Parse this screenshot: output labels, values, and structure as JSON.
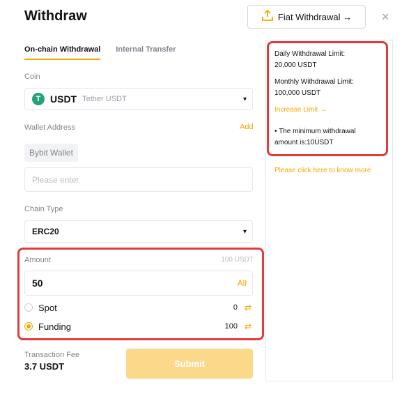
{
  "header": {
    "title": "Withdraw",
    "fiat_button": "Fiat Withdrawal →",
    "close": "×"
  },
  "tabs": [
    {
      "label": "On-chain Withdrawal",
      "active": true
    },
    {
      "label": "Internal Transfer",
      "active": false
    }
  ],
  "coin": {
    "label": "Coin",
    "code": "USDT",
    "name": "Tether USDT",
    "icon_letter": "T"
  },
  "wallet": {
    "label": "Wallet Address",
    "add_link": "Add",
    "tag": "Bybit Wallet",
    "placeholder": "Please enter"
  },
  "chain": {
    "label": "Chain Type",
    "value": "ERC20"
  },
  "amount": {
    "label": "Amount",
    "max": "100 USDT",
    "value": "50",
    "all_button": "All",
    "accounts": [
      {
        "label": "Spot",
        "balance": "0",
        "selected": false
      },
      {
        "label": "Funding",
        "balance": "100",
        "selected": true
      }
    ]
  },
  "fee": {
    "label": "Transaction Fee",
    "value": "3.7 USDT"
  },
  "submit_label": "Submit",
  "side_panel": {
    "daily_label": "Daily Withdrawal Limit:",
    "daily_value": "20,000 USDT",
    "monthly_label": "Monthly Withdrawal Limit:",
    "monthly_value": "100,000 USDT",
    "increase_link": "Increase Limit →",
    "min_note_line1": "• The minimum withdrawal",
    "min_note_line2": "amount is:10USDT",
    "know_more_link": "Please click here to know more"
  },
  "colors": {
    "accent": "#f7a600",
    "highlight_border": "#e03c3c",
    "usdt_green": "#26a17b"
  }
}
